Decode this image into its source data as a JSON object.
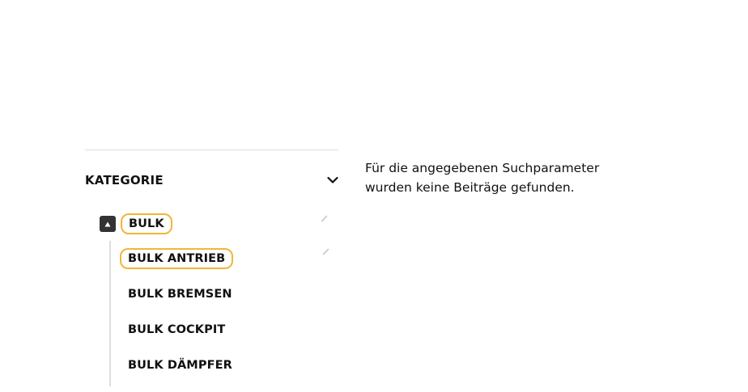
{
  "filter": {
    "title": "KATEGORIE",
    "expand_icon": "chevron-down-icon"
  },
  "tree": {
    "root": {
      "label": "BULK",
      "toggle_icon": "triangle-up-icon",
      "edit_icon": "pencil-icon",
      "active": true
    },
    "children": [
      {
        "label": "BULK ANTRIEB",
        "active": true,
        "edit_icon": "pencil-icon"
      },
      {
        "label": "BULK BREMSEN",
        "active": false
      },
      {
        "label": "BULK COCKPIT",
        "active": false
      },
      {
        "label": "BULK DÄMPFER",
        "active": false
      }
    ]
  },
  "content": {
    "message": "Für die angegebenen Suchparameter wurden keine Beiträge gefunden."
  },
  "colors": {
    "active_outline": "#f0b63a",
    "toggle_bg": "#333333",
    "divider": "#dcdcdc",
    "tree_line": "#dddddd"
  }
}
